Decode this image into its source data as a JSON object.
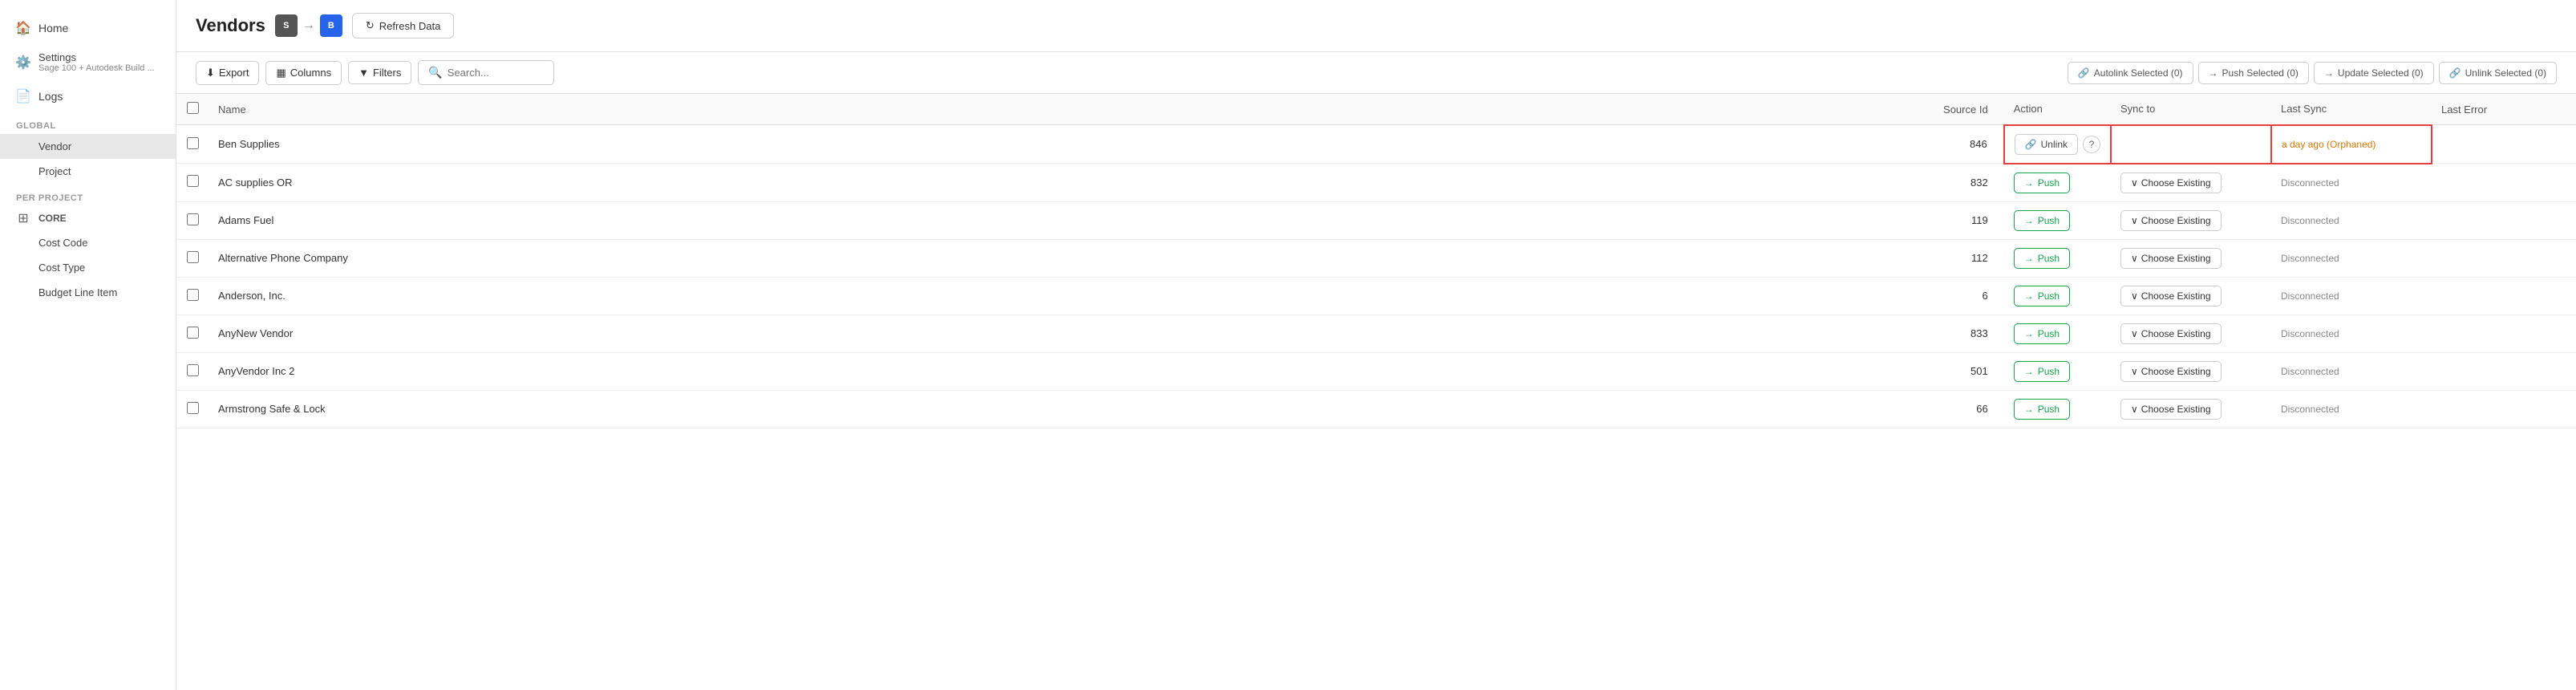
{
  "sidebar": {
    "items": [
      {
        "id": "home",
        "label": "Home",
        "icon": "🏠",
        "type": "top"
      },
      {
        "id": "settings",
        "label": "Settings",
        "sublabel": "Sage 100 + Autodesk Build ...",
        "icon": "⚙️",
        "type": "top"
      },
      {
        "id": "logs",
        "label": "Logs",
        "icon": "📄",
        "type": "top"
      }
    ],
    "sections": [
      {
        "label": "GLOBAL",
        "items": [
          {
            "id": "vendor",
            "label": "Vendor",
            "active": true
          },
          {
            "id": "project",
            "label": "Project"
          }
        ]
      },
      {
        "label": "PER PROJECT",
        "items": [
          {
            "id": "core",
            "label": "CORE",
            "isHeader": true
          },
          {
            "id": "cost-code",
            "label": "Cost Code"
          },
          {
            "id": "cost-type",
            "label": "Cost Type"
          },
          {
            "id": "budget-line-item",
            "label": "Budget Line Item"
          }
        ]
      }
    ]
  },
  "header": {
    "title": "Vendors",
    "badge_left": "S",
    "badge_right": "B",
    "refresh_label": "Refresh Data"
  },
  "toolbar": {
    "export_label": "Export",
    "columns_label": "Columns",
    "filters_label": "Filters",
    "search_placeholder": "Search...",
    "autolink_label": "Autolink Selected (0)",
    "push_selected_label": "Push Selected (0)",
    "update_selected_label": "Update Selected (0)",
    "unlink_selected_label": "Unlink Selected (0)"
  },
  "table": {
    "columns": [
      "",
      "Name",
      "Source Id",
      "Action",
      "Sync to",
      "Last Sync",
      "Last Error"
    ],
    "rows": [
      {
        "id": 1,
        "name": "Ben Supplies",
        "source_id": "846",
        "action_type": "orphaned",
        "action_label": "Unlink",
        "sync_to": "",
        "last_sync": "a day ago (Orphaned)",
        "last_error": "",
        "highlighted": true
      },
      {
        "id": 2,
        "name": "AC supplies OR",
        "source_id": "832",
        "action_type": "push",
        "action_label": "Push",
        "sync_to": "Choose Existing",
        "last_sync": "Disconnected",
        "last_error": ""
      },
      {
        "id": 3,
        "name": "Adams Fuel",
        "source_id": "119",
        "action_type": "push",
        "action_label": "Push",
        "sync_to": "Choose Existing",
        "last_sync": "Disconnected",
        "last_error": ""
      },
      {
        "id": 4,
        "name": "Alternative Phone Company",
        "source_id": "112",
        "action_type": "push",
        "action_label": "Push",
        "sync_to": "Choose Existing",
        "last_sync": "Disconnected",
        "last_error": ""
      },
      {
        "id": 5,
        "name": "Anderson, Inc.",
        "source_id": "6",
        "action_type": "push",
        "action_label": "Push",
        "sync_to": "Choose Existing",
        "last_sync": "Disconnected",
        "last_error": ""
      },
      {
        "id": 6,
        "name": "AnyNew Vendor",
        "source_id": "833",
        "action_type": "push",
        "action_label": "Push",
        "sync_to": "Choose Existing",
        "last_sync": "Disconnected",
        "last_error": ""
      },
      {
        "id": 7,
        "name": "AnyVendor Inc 2",
        "source_id": "501",
        "action_type": "push",
        "action_label": "Push",
        "sync_to": "Choose Existing",
        "last_sync": "Disconnected",
        "last_error": ""
      },
      {
        "id": 8,
        "name": "Armstrong Safe & Lock",
        "source_id": "66",
        "action_type": "push",
        "action_label": "Push",
        "sync_to": "Choose Existing",
        "last_sync": "Disconnected",
        "last_error": ""
      }
    ]
  },
  "colors": {
    "push_green": "#16a34a",
    "orphaned_orange": "#d97706",
    "highlight_red": "#e53e3e",
    "disconnected_gray": "#888"
  }
}
